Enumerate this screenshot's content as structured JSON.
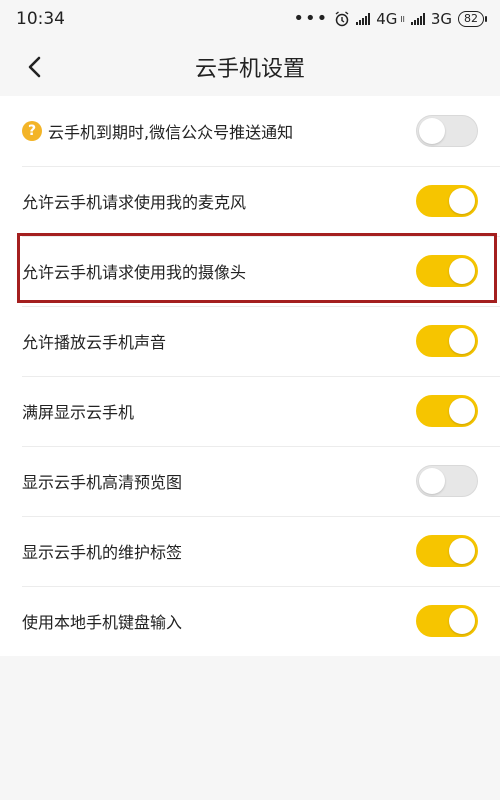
{
  "status_bar": {
    "time": "10:34",
    "net1": "4G",
    "net1_sub": "ll",
    "net2": "3G",
    "battery": "82"
  },
  "header": {
    "title": "云手机设置"
  },
  "settings": [
    {
      "label": "云手机到期时,微信公众号推送通知",
      "on": false,
      "icon": "question-icon"
    },
    {
      "label": "允许云手机请求使用我的麦克风",
      "on": true
    },
    {
      "label": "允许云手机请求使用我的摄像头",
      "on": true,
      "highlighted": true
    },
    {
      "label": "允许播放云手机声音",
      "on": true
    },
    {
      "label": "满屏显示云手机",
      "on": true
    },
    {
      "label": "显示云手机高清预览图",
      "on": false
    },
    {
      "label": "显示云手机的维护标签",
      "on": true
    },
    {
      "label": "使用本地手机键盘输入",
      "on": true
    }
  ],
  "colors": {
    "toggle_on": "#f6c500",
    "toggle_off": "#e7e7e7",
    "highlight_border": "#a41f1f",
    "help_icon": "#f3b427"
  }
}
